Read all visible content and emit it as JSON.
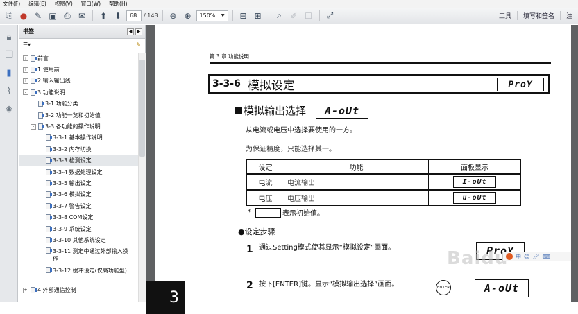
{
  "menu": {
    "items": [
      "文件(F)",
      "编辑(E)",
      "视图(V)",
      "窗口(W)",
      "帮助(H)"
    ]
  },
  "toolbar": {
    "icons": [
      "create-icon",
      "open-icon",
      "edit-icon",
      "save-icon",
      "print-icon",
      "email-icon",
      "page-up-icon",
      "page-down-icon",
      "zoom-out-icon",
      "zoom-in-icon",
      "fit-page-icon",
      "full-screen-icon",
      "find-icon",
      "sign-icon",
      "comment-icon",
      "expand-icon"
    ],
    "page_current": "68",
    "page_total": "/ 148",
    "zoom": "150%",
    "right_buttons": [
      "工具",
      "填写和签名",
      "注"
    ]
  },
  "sidebar": {
    "icons": [
      "lock-icon",
      "pages-icon",
      "bookmark-icon",
      "attachment-icon",
      "layers-icon"
    ]
  },
  "bookmarks": {
    "title": "书签",
    "items": [
      {
        "label": "前言",
        "level": 0,
        "toggle": "+"
      },
      {
        "label": "1  使用前",
        "level": 0,
        "toggle": "+"
      },
      {
        "label": "2  输入输出线",
        "level": 0,
        "toggle": "+"
      },
      {
        "label": "3  功能说明",
        "level": 0,
        "toggle": "-"
      },
      {
        "label": "3-1  功能分类",
        "level": 1,
        "toggle": ""
      },
      {
        "label": "3-2  功能一览和初始值",
        "level": 1,
        "toggle": ""
      },
      {
        "label": "3-3  各功能的操作说明",
        "level": 1,
        "toggle": "-"
      },
      {
        "label": "3-3-1  基本操作说明",
        "level": 2,
        "toggle": ""
      },
      {
        "label": "3-3-2  内存切换",
        "level": 2,
        "toggle": ""
      },
      {
        "label": "3-3-3  检测设定",
        "level": 2,
        "toggle": "",
        "selected": true
      },
      {
        "label": "3-3-4  数据处理设定",
        "level": 2,
        "toggle": ""
      },
      {
        "label": "3-3-5  输出设定",
        "level": 2,
        "toggle": ""
      },
      {
        "label": "3-3-6  模拟设定",
        "level": 2,
        "toggle": ""
      },
      {
        "label": "3-3-7  警告设定",
        "level": 2,
        "toggle": ""
      },
      {
        "label": "3-3-8  COM设定",
        "level": 2,
        "toggle": ""
      },
      {
        "label": "3-3-9  系统设定",
        "level": 2,
        "toggle": ""
      },
      {
        "label": "3-3-10  其他系统设定",
        "level": 2,
        "toggle": ""
      },
      {
        "label": "3-3-11  测定中通过外部输入操作",
        "level": 2,
        "toggle": "",
        "two_line": true
      },
      {
        "label": "3-3-12  缓冲设定(仅高功能型)",
        "level": 2,
        "toggle": "",
        "two_line": true
      },
      {
        "label": "4  外部通信控制",
        "level": 0,
        "toggle": "+"
      }
    ]
  },
  "document": {
    "chapter_tab": "3",
    "header": "第 3 章  功能说明",
    "section_num": "3-3-6",
    "section_title": "模拟设定",
    "section_seg": "ProY",
    "sub_title": "模拟输出选择",
    "sub_seg": "A-oUt",
    "para1": "从电流或电压中选择要使用的一方。",
    "para2": "为保证精度，只能选择其一。",
    "table": {
      "headers": [
        "设定",
        "功能",
        "面板显示"
      ],
      "rows": [
        {
          "setting": "电流",
          "function": "电流输出",
          "display": "I-oUt"
        },
        {
          "setting": "电压",
          "function": "电压输出",
          "display": "u-oUt"
        }
      ]
    },
    "note_star": "*",
    "note_text": "表示初始值。",
    "steps_head": "●设定步骤",
    "steps": [
      {
        "num": "1",
        "text": "通过Setting模式使其显示“模拟设定”画面。",
        "seg": "ProY"
      },
      {
        "num": "2",
        "text": "按下[ENTER]键。显示“模拟输出选择”画面。",
        "seg": "A-oUt",
        "icon": "ENTER"
      }
    ],
    "watermark": "Baidu"
  }
}
